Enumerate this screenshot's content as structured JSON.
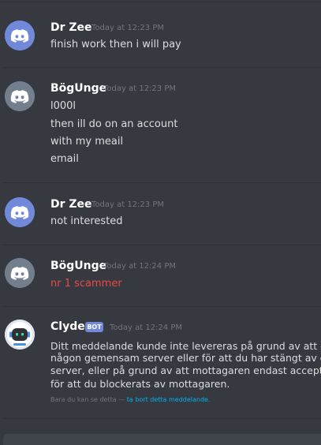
{
  "messages": [
    {
      "author": "Dr Zee",
      "author_color": "#ffffff",
      "timestamp": "Today at 12:23 PM",
      "avatar_icon": "discord-logo-icon",
      "avatar_color": "#7289da",
      "lines": [
        "finish work then i will pay"
      ]
    },
    {
      "author": "BögUnge",
      "author_color": "#ffffff",
      "timestamp": "Today at 12:23 PM",
      "avatar_icon": "discord-logo-icon",
      "avatar_color": "#747f8d",
      "lines": [
        "l000l",
        "then ill do on an account",
        "with my meail",
        "email"
      ]
    },
    {
      "author": "Dr Zee",
      "author_color": "#ffffff",
      "timestamp": "Today at 12:23 PM",
      "avatar_icon": "discord-logo-icon",
      "avatar_color": "#7289da",
      "lines": [
        "not interested"
      ]
    },
    {
      "author": "BögUnge",
      "author_color": "#ffffff",
      "timestamp": "Today at 12:24 PM",
      "avatar_icon": "discord-logo-icon",
      "avatar_color": "#747f8d",
      "lines": [
        "nr 1 scammer"
      ],
      "line_color": "#f04747"
    }
  ],
  "system_message": {
    "author": "Clyde",
    "badge": "BOT",
    "timestamp": "Today at 12:24 PM",
    "avatar_icon": "clyde-bot-icon",
    "lines": [
      "Ditt meddelande kunde inte levereras på grund av att du",
      "någon gemensam server eller för att du har stängt av di",
      "server, eller på grund av att mottagaren endast accepte",
      "för att du blockerats av mottagaren."
    ],
    "ephemeral_note": "Bara du kan se detta —",
    "dismiss_link": "ta bort detta meddelande."
  },
  "colors": {
    "background": "#36393f",
    "muted": "#72767d",
    "link": "#00b0f4",
    "bot_badge": "#7289da"
  }
}
